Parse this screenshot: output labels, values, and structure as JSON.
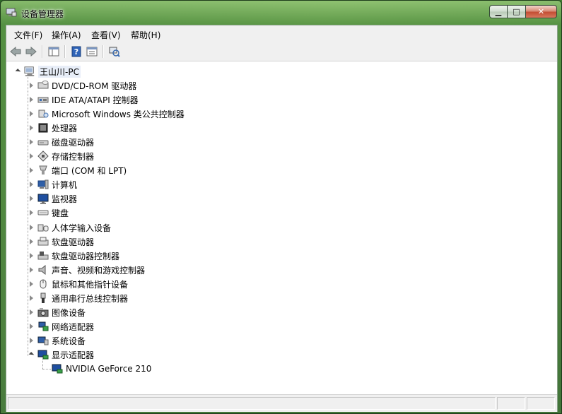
{
  "window": {
    "title": "设备管理器",
    "buttons": {
      "minimize": "▁",
      "maximize": "□",
      "close": "✕"
    }
  },
  "menu": {
    "items": [
      "文件(F)",
      "操作(A)",
      "查看(V)",
      "帮助(H)"
    ]
  },
  "toolbar": {
    "buttons": [
      "back-icon",
      "forward-icon",
      "console-tree-icon",
      "help-icon",
      "properties-icon",
      "scan-hardware-icon"
    ]
  },
  "tree": {
    "root": "王山川-PC",
    "categories": [
      {
        "label": "DVD/CD-ROM 驱动器",
        "icon": "dvd-drive-icon"
      },
      {
        "label": "IDE ATA/ATAPI 控制器",
        "icon": "ide-controller-icon"
      },
      {
        "label": "Microsoft Windows 类公共控制器",
        "icon": "usb-controller-icon"
      },
      {
        "label": "处理器",
        "icon": "processor-icon"
      },
      {
        "label": "磁盘驱动器",
        "icon": "disk-drive-icon"
      },
      {
        "label": "存储控制器",
        "icon": "storage-controller-icon"
      },
      {
        "label": "端口 (COM 和 LPT)",
        "icon": "port-icon"
      },
      {
        "label": "计算机",
        "icon": "computer-icon"
      },
      {
        "label": "监视器",
        "icon": "monitor-icon"
      },
      {
        "label": "键盘",
        "icon": "keyboard-icon"
      },
      {
        "label": "人体学输入设备",
        "icon": "hid-icon"
      },
      {
        "label": "软盘驱动器",
        "icon": "floppy-drive-icon"
      },
      {
        "label": "软盘驱动器控制器",
        "icon": "floppy-controller-icon"
      },
      {
        "label": "声音、视频和游戏控制器",
        "icon": "speaker-icon"
      },
      {
        "label": "鼠标和其他指针设备",
        "icon": "mouse-icon"
      },
      {
        "label": "通用串行总线控制器",
        "icon": "usb-plug-icon"
      },
      {
        "label": "图像设备",
        "icon": "camera-icon"
      },
      {
        "label": "网络适配器",
        "icon": "network-adapter-icon"
      },
      {
        "label": "系统设备",
        "icon": "system-device-icon"
      },
      {
        "label": "显示适配器",
        "icon": "display-adapter-icon",
        "expanded": true
      }
    ],
    "children": [
      {
        "label": "NVIDIA GeForce 210",
        "icon": "display-adapter-icon"
      }
    ]
  }
}
